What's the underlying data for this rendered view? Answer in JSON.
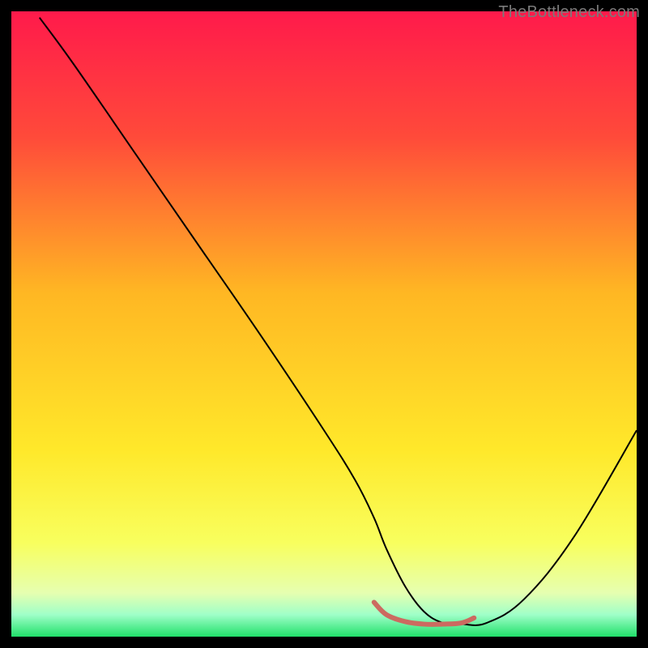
{
  "watermark": "TheBottleneck.com",
  "chart_data": {
    "type": "line",
    "title": "",
    "xlabel": "",
    "ylabel": "",
    "xlim": [
      0,
      100
    ],
    "ylim": [
      0,
      100
    ],
    "gradient_stops": [
      {
        "offset": 0.0,
        "color": "#ff1a4b"
      },
      {
        "offset": 0.2,
        "color": "#ff4a3a"
      },
      {
        "offset": 0.45,
        "color": "#ffb723"
      },
      {
        "offset": 0.7,
        "color": "#ffe82a"
      },
      {
        "offset": 0.85,
        "color": "#f8ff5e"
      },
      {
        "offset": 0.93,
        "color": "#e6ffb0"
      },
      {
        "offset": 0.965,
        "color": "#9fffc8"
      },
      {
        "offset": 1.0,
        "color": "#21e06a"
      }
    ],
    "series": [
      {
        "name": "bottleneck-curve",
        "color": "#000000",
        "stroke_width": 2,
        "x": [
          4.5,
          10,
          20,
          30,
          40,
          50,
          55,
          58,
          60,
          63,
          66,
          69,
          72,
          76,
          82,
          90,
          100
        ],
        "values": [
          99,
          91.5,
          77,
          62.5,
          48,
          33,
          25,
          19,
          14,
          8,
          4,
          2.2,
          2.0,
          2.2,
          6,
          16,
          33
        ]
      },
      {
        "name": "highlight-segment",
        "color": "#cc6a60",
        "stroke_width": 6,
        "x": [
          58,
          60,
          63,
          66,
          69,
          72,
          74
        ],
        "values": [
          5.5,
          3.5,
          2.4,
          2.0,
          2.0,
          2.2,
          3.0
        ]
      }
    ]
  }
}
